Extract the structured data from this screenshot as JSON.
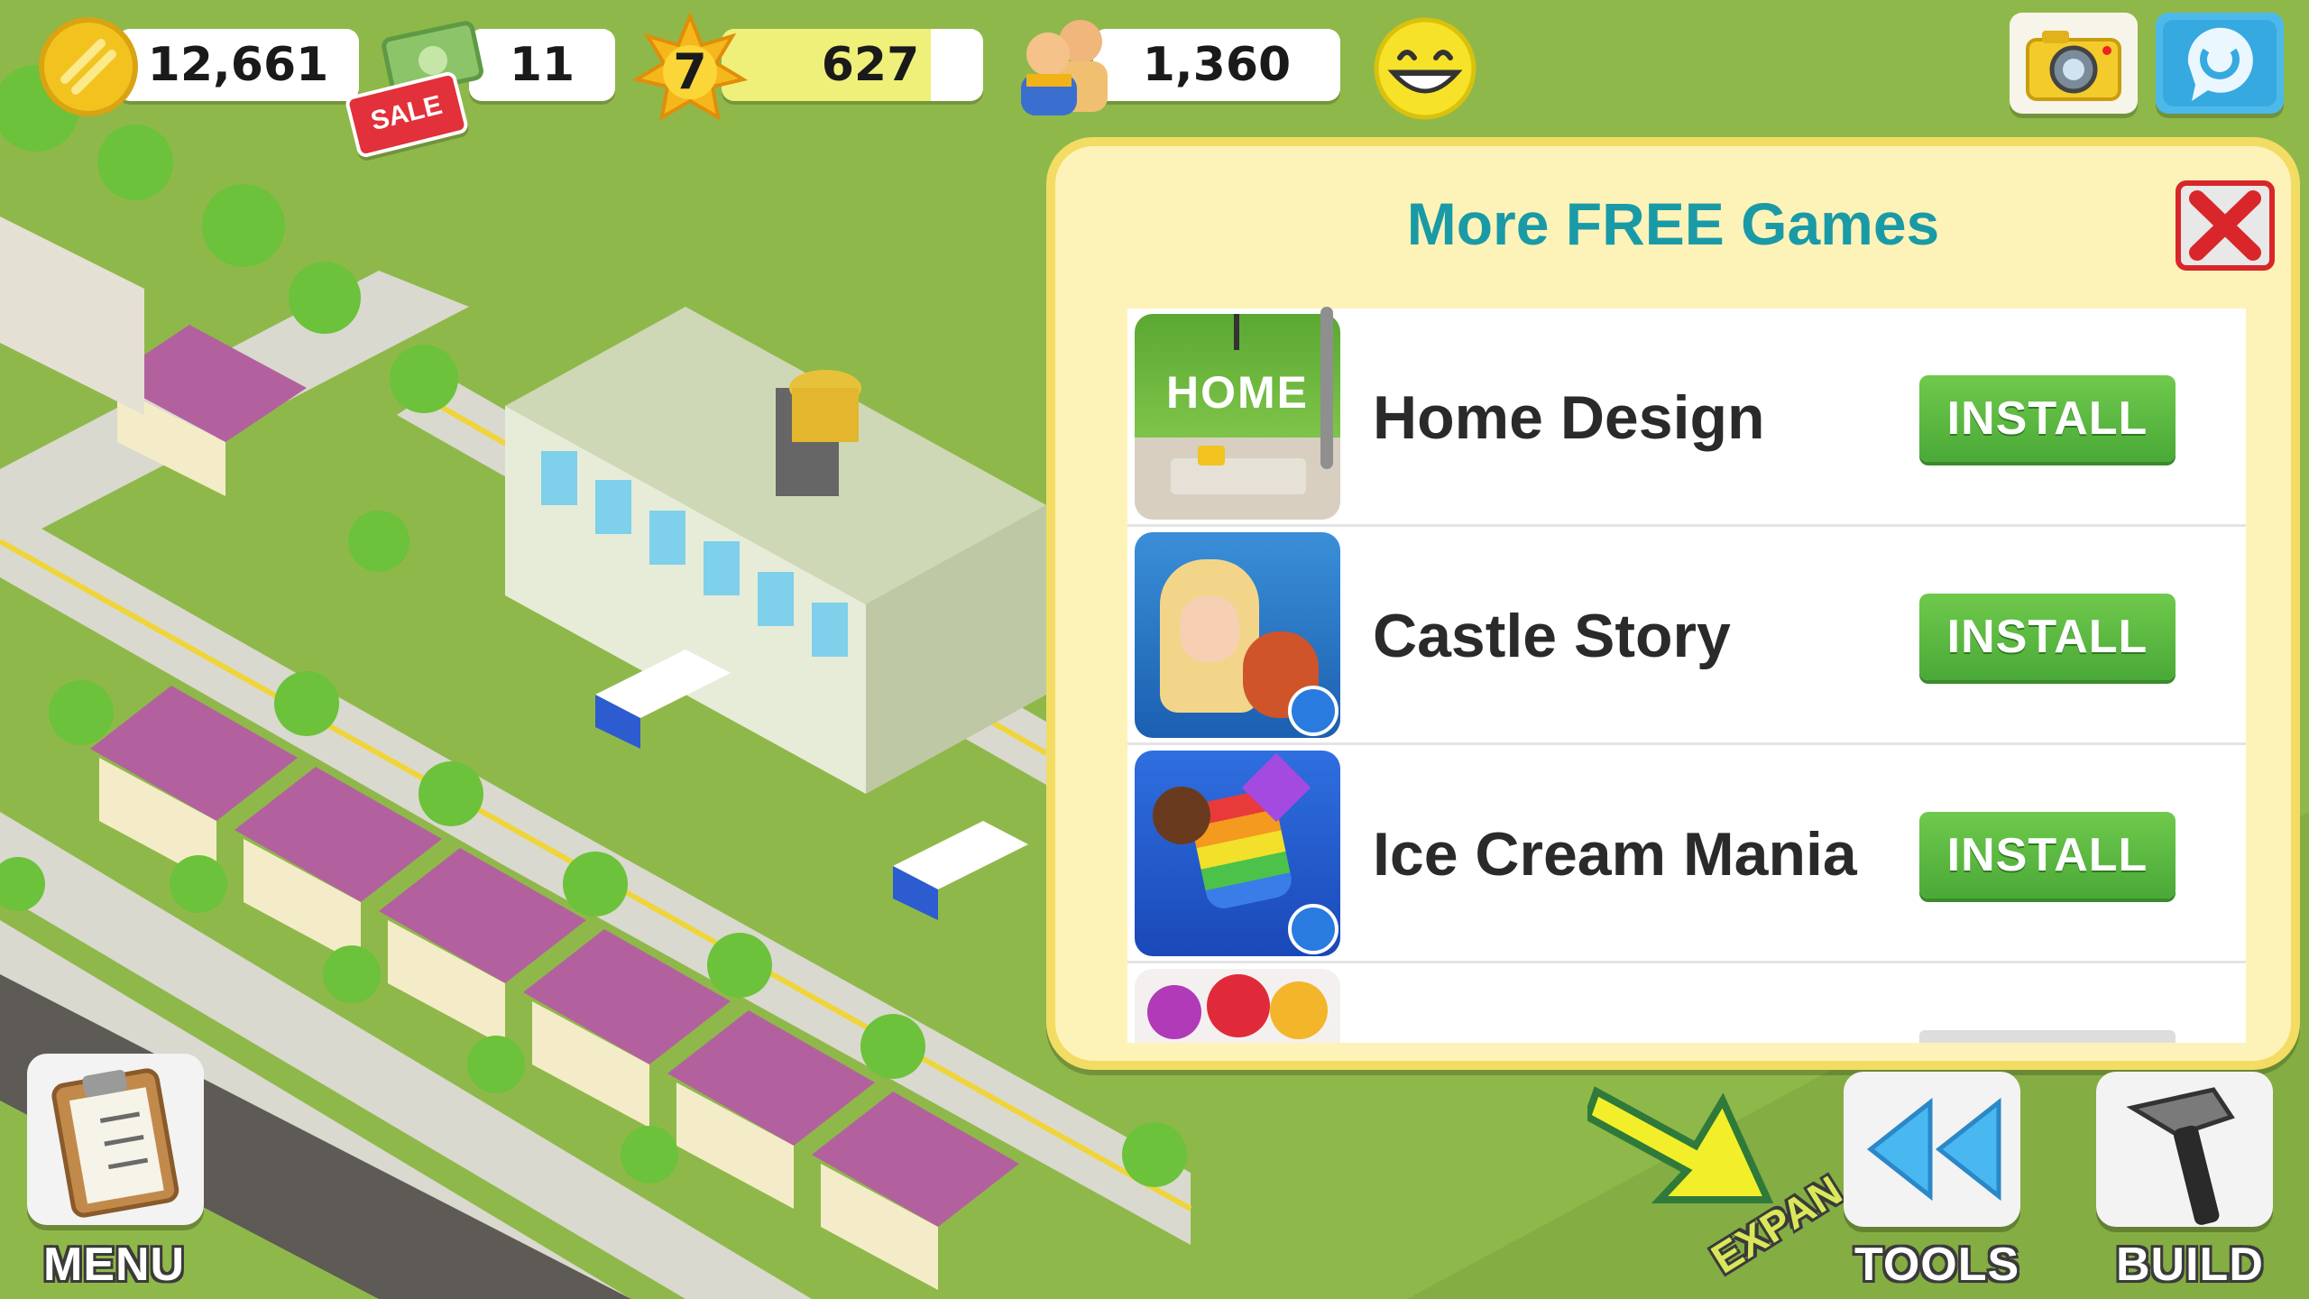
{
  "hud": {
    "coins": "12,661",
    "cash": "11",
    "sale_badge": "SALE",
    "level": "7",
    "xp": "627",
    "xp_progress": 0.8,
    "population": "1,360"
  },
  "popup": {
    "title": "More FREE Games",
    "games": [
      {
        "name": "Home Design",
        "button": "INSTALL",
        "icon_text": "HOME"
      },
      {
        "name": "Castle Story",
        "button": "INSTALL"
      },
      {
        "name": "Ice Cream Mania",
        "button": "INSTALL"
      }
    ]
  },
  "bottom": {
    "menu_label": "MENU",
    "tools_label": "TOOLS",
    "build_label": "BUILD",
    "expand_label": "EXPAN"
  },
  "colors": {
    "grass": "#8fb84a",
    "popup_bg": "#fdf3b8",
    "popup_border": "#f3dc63",
    "title": "#1a9aa6",
    "install_green": "#4aa937",
    "close_red": "#d8262a"
  }
}
